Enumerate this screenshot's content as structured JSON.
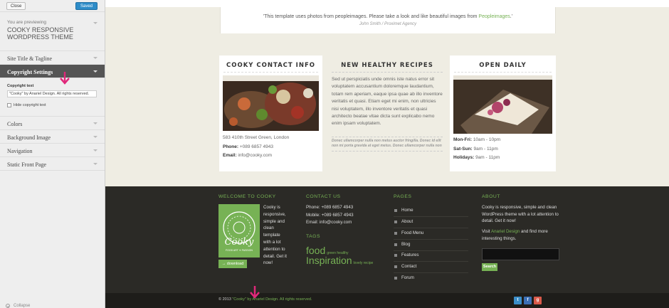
{
  "sidebar": {
    "close_label": "Close",
    "saved_label": "Saved",
    "previewing_label": "You are previewing",
    "theme_name": "COOKY RESPONSIVE WORDPRESS THEME",
    "sections": [
      "Site Title & Tagline",
      "Copyright Settings",
      "Colors",
      "Background Image",
      "Navigation",
      "Static Front Page"
    ],
    "active_section": "Copyright Settings",
    "copyright_text_label": "Copyright text",
    "copyright_text_value": "\"Cooky\" by Anariel Design. All rights reserved.",
    "hide_copyright_label": "Hide copyright text",
    "collapse_label": "Collapse"
  },
  "quote": {
    "text": "'This template uses photos from peopleimages. Please take a look and like beautiful images from ",
    "link": "Peopleimages",
    "end": ".'",
    "author": "John Smith / Proximet Agency"
  },
  "contact_card": {
    "title": "COOKY CONTACT INFO",
    "address": "583 410th Street Green, London",
    "phone_label": "Phone:",
    "phone": " +089 6857 4943",
    "email_label": "Email:",
    "email": " info@cooky.com"
  },
  "recipes": {
    "title": "NEW HEALTHY RECIPES",
    "body": "Sed ut perspiciatis unde omnis iste natus error sit voluptatem accusantium doloremque laudantium, totam rem aperiam, eaque ipsa quae ab illo inventore veritatis et quasi. Etiam eget mi enim, non ultricies nisi voluptatem, illo inventore veritatis et quasi architecto beatae vitae dicta sunt explicabo nemo enim ipsam voluptatem.",
    "note": "Donec ullamcorper nulla non metus auctor fringilla. Donec id elit non mi porta gravida at eget metus. Donec ullamcorper nulla non"
  },
  "open_card": {
    "title": "OPEN DAILY",
    "rows": [
      {
        "day": "Mon-Fri:",
        "hours": "10am - 10pm"
      },
      {
        "day": "Sat-Sun:",
        "hours": "9am - 11pm"
      },
      {
        "day": "Holidays:",
        "hours": "9am - 11pm"
      }
    ]
  },
  "footer": {
    "welcome_title": "WELCOME TO COOKY",
    "welcome_text": "Cooky is responsive, simple and clean template with a lot attention to detail. Get it now!",
    "logo_text": "Cooky",
    "logo_sub": "FOOD ART ✦ PASSION",
    "download_label": "→ download",
    "contact_title": "CONTACT US",
    "contact_lines": [
      "Phone: +089 6857 4943",
      "Mobile: +089 6857 4943",
      "Email: info@cooky.com"
    ],
    "tags_title": "TAGS",
    "tag_food": "food",
    "tag_green": "green healthy",
    "tag_inspiration": "Inspiration",
    "tag_lovely": "lovely recipe",
    "pages_title": "PAGES",
    "pages": [
      "Home",
      "About",
      "Food Menu",
      "Blog",
      "Features",
      "Contact",
      "Forum"
    ],
    "about_title": "ABOUT",
    "about_text": "Cooky is responsive, simple and clean WordPress theme with a lot attention to detail. Get it now!",
    "about_visit_pre": "Visit ",
    "about_visit_link": "Anariel Design",
    "about_visit_post": " and find more interesting things.",
    "search_label": "Search"
  },
  "bottom": {
    "copyright_pre": "© 2013 ",
    "copyright_link": "\"Cooky\" by Anariel Design. All rights reserved."
  },
  "social": [
    "twitter-icon",
    "facebook-icon",
    "google-plus-icon"
  ],
  "colors": {
    "accent": "#77b255",
    "saved_button": "#2e8cc8",
    "marker": "#e0287a"
  }
}
